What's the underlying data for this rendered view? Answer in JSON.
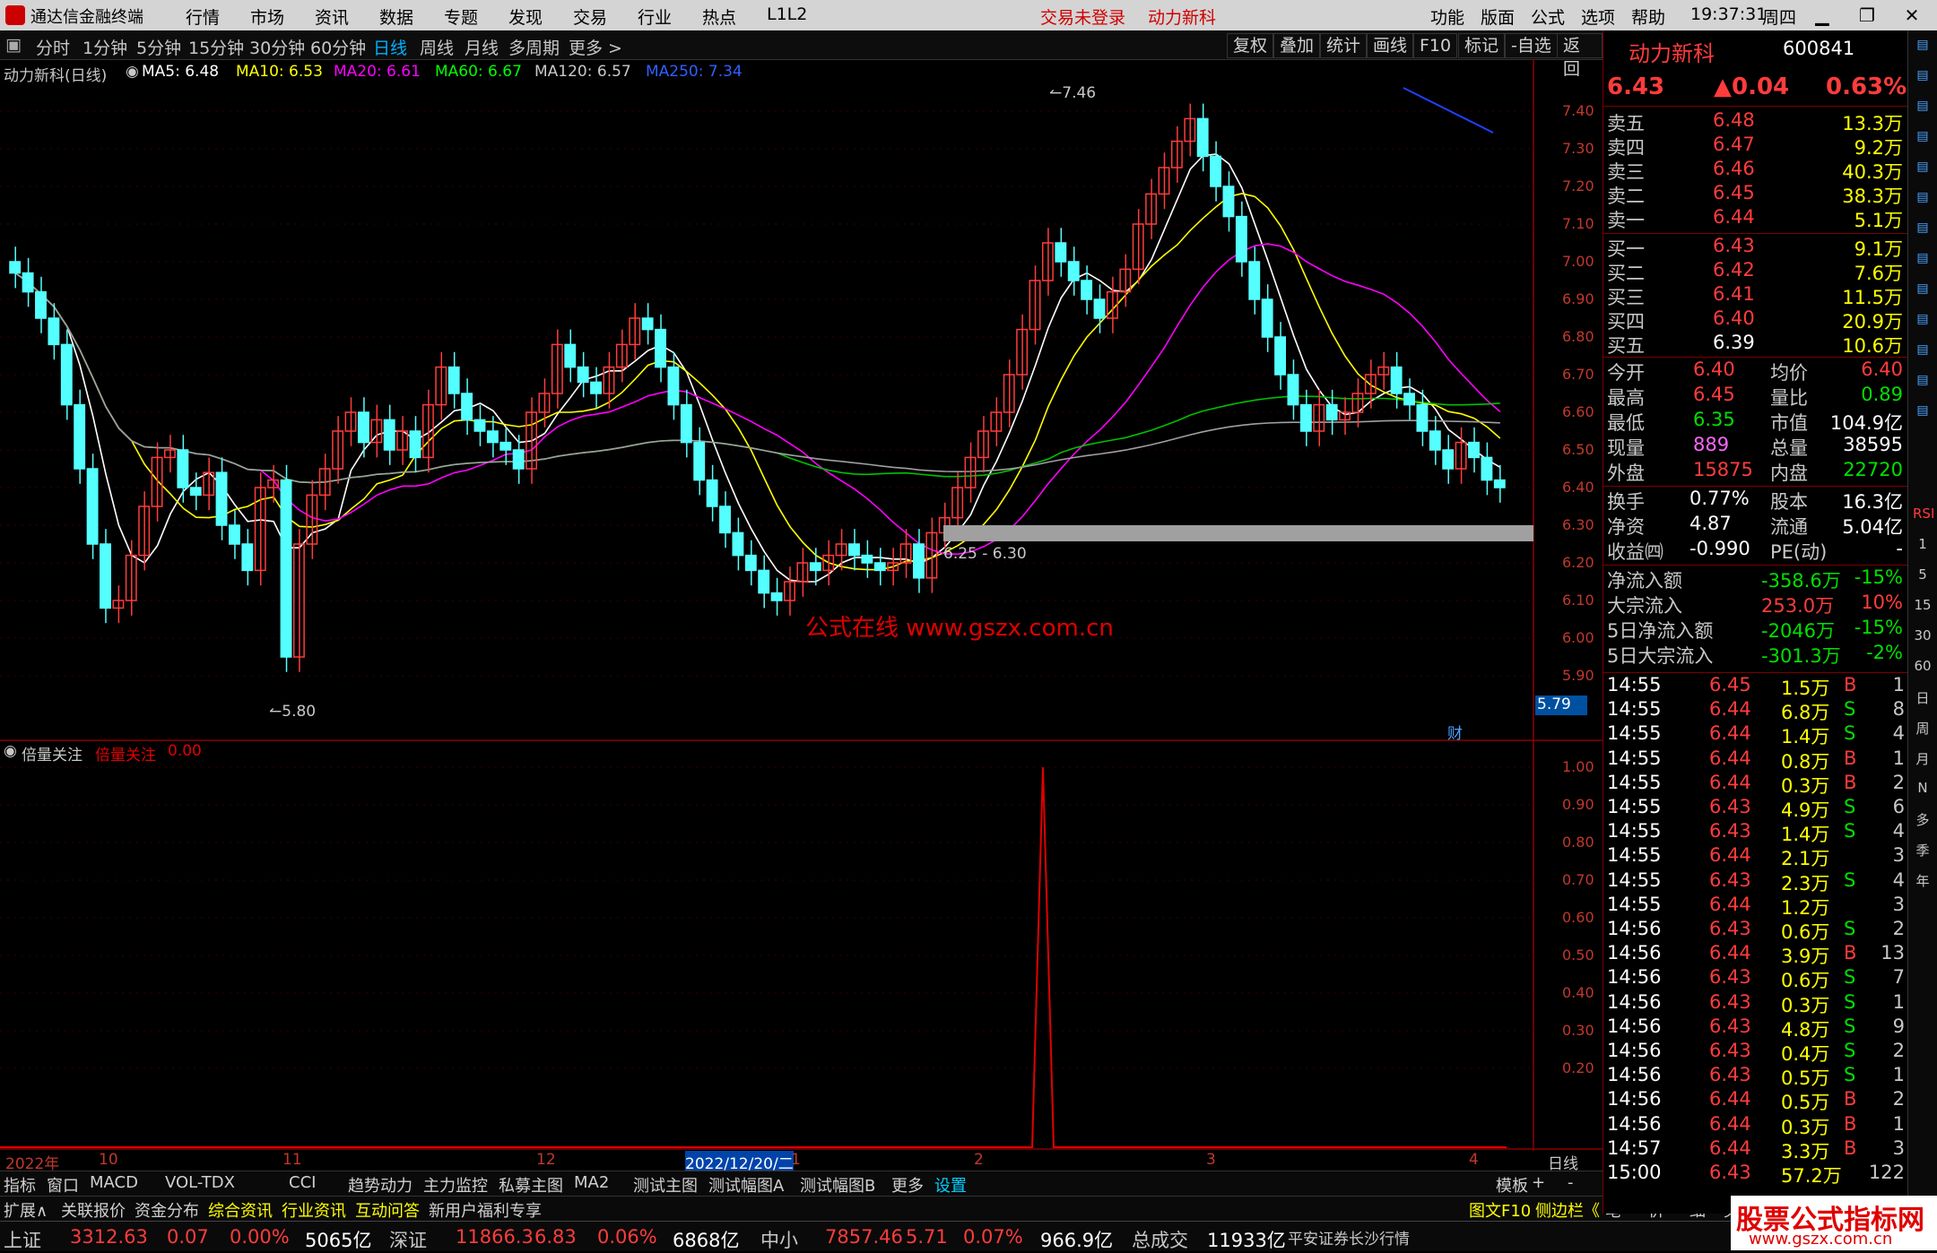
{
  "titlebar": {
    "app_name": "通达信金融终端",
    "menus": [
      "行情",
      "市场",
      "资讯",
      "数据",
      "专题",
      "发现",
      "交易",
      "行业",
      "热点",
      "L1L2"
    ],
    "trade_status": "交易未登录",
    "stock_name": "动力新科",
    "right_menus": [
      "功能",
      "版面",
      "公式",
      "选项",
      "帮助"
    ],
    "time": "19:37:31",
    "weekday": "周四"
  },
  "toolbar": {
    "periods": [
      "分时",
      "1分钟",
      "5分钟",
      "15分钟",
      "30分钟",
      "60分钟",
      "日线",
      "周线",
      "月线",
      "多周期",
      "更多 >"
    ],
    "active_period": "日线",
    "right_buttons": [
      "复权",
      "叠加",
      "统计",
      "画线",
      "F10",
      "标记",
      "-自选",
      "返回"
    ]
  },
  "chart": {
    "title": "动力新科(日线)",
    "ma": [
      {
        "label": "MA5: 6.48",
        "color": "#ffffff"
      },
      {
        "label": "MA10: 6.53",
        "color": "#ffff00"
      },
      {
        "label": "MA20: 6.61",
        "color": "#ff00ff"
      },
      {
        "label": "MA60: 6.67",
        "color": "#00ff00"
      },
      {
        "label": "MA120: 6.57",
        "color": "#c8c8c8"
      },
      {
        "label": "MA250: 7.34",
        "color": "#3060ff"
      }
    ],
    "price_ticks": [
      "7.40",
      "7.30",
      "7.20",
      "7.10",
      "7.00",
      "6.90",
      "6.80",
      "6.70",
      "6.60",
      "6.50",
      "6.40",
      "6.30",
      "6.20",
      "6.10",
      "6.00",
      "5.90"
    ],
    "annot_high": "7.46",
    "annot_low": "5.80",
    "annot_range": "6.25 - 6.30",
    "watermark": "公式在线  www.gszx.com.cn",
    "last_price_box": "5.79",
    "cai_label": "财",
    "date_labels": [
      "2022年",
      "10",
      "11",
      "12",
      "2022/12/20/二",
      "1",
      "2",
      "3",
      "4"
    ],
    "period_label": "日线"
  },
  "indicator": {
    "name": "倍量关注",
    "name2": "倍量关注",
    "value": "0.00",
    "ticks": [
      "1.00",
      "0.90",
      "0.80",
      "0.70",
      "0.60",
      "0.50",
      "0.40",
      "0.30",
      "0.20"
    ]
  },
  "bottom_tabs": [
    "指标",
    "窗口",
    "MACD",
    "VOL-TDX",
    "CCI",
    "趋势动力",
    "主力监控",
    "私募主图",
    "MA2",
    "测试主图",
    "测试幅图A",
    "测试幅图B",
    "更多",
    "设置"
  ],
  "bottom_tabs_right": [
    "模板",
    "+",
    "-"
  ],
  "bottom_tabs2": [
    {
      "label": "扩展∧",
      "color": "#d0d0d0"
    },
    {
      "label": "关联报价",
      "color": "#d0d0d0"
    },
    {
      "label": "资金分布",
      "color": "#d0d0d0"
    },
    {
      "label": "综合资讯",
      "color": "#ffff00"
    },
    {
      "label": "行业资讯",
      "color": "#ffff00"
    },
    {
      "label": "互动问答",
      "color": "#ffff00"
    },
    {
      "label": "新用户福利专享",
      "color": "#d0d0d0"
    }
  ],
  "bottom_right2": [
    "图文F10",
    "侧边栏《",
    "笔",
    "价",
    "细",
    "势"
  ],
  "quote": {
    "name": "动力新科",
    "code": "600841",
    "price": "6.43",
    "change": "▲0.04",
    "pct": "0.63%",
    "asks": [
      {
        "label": "卖五",
        "price": "6.48",
        "vol": "13.3万"
      },
      {
        "label": "卖四",
        "price": "6.47",
        "vol": "9.2万"
      },
      {
        "label": "卖三",
        "price": "6.46",
        "vol": "40.3万"
      },
      {
        "label": "卖二",
        "price": "6.45",
        "vol": "38.3万"
      },
      {
        "label": "卖一",
        "price": "6.44",
        "vol": "5.1万"
      }
    ],
    "bids": [
      {
        "label": "买一",
        "price": "6.43",
        "vol": "9.1万"
      },
      {
        "label": "买二",
        "price": "6.42",
        "vol": "7.6万"
      },
      {
        "label": "买三",
        "price": "6.41",
        "vol": "11.5万"
      },
      {
        "label": "买四",
        "price": "6.40",
        "vol": "20.9万"
      },
      {
        "label": "买五",
        "price": "6.39",
        "vol": "10.6万"
      }
    ],
    "stats": [
      {
        "l1": "今开",
        "v1": "6.40",
        "c1": "#ff3c3c",
        "l2": "均价",
        "v2": "6.40",
        "c2": "#ff3c3c"
      },
      {
        "l1": "最高",
        "v1": "6.45",
        "c1": "#ff3c3c",
        "l2": "量比",
        "v2": "0.89",
        "c2": "#00e000"
      },
      {
        "l1": "最低",
        "v1": "6.35",
        "c1": "#00e000",
        "l2": "市值",
        "v2": "104.9亿",
        "c2": "#ffffff"
      },
      {
        "l1": "现量",
        "v1": "889",
        "c1": "#ff66ff",
        "l2": "总量",
        "v2": "38595",
        "c2": "#ffffff"
      },
      {
        "l1": "外盘",
        "v1": "15875",
        "c1": "#ff3c3c",
        "l2": "内盘",
        "v2": "22720",
        "c2": "#00e000"
      }
    ],
    "stats2": [
      {
        "l1": "换手",
        "v1": "0.77%",
        "l2": "股本",
        "v2": "16.3亿"
      },
      {
        "l1": "净资",
        "v1": "4.87",
        "l2": "流通",
        "v2": "5.04亿"
      },
      {
        "l1": "收益㈣",
        "v1": "-0.990",
        "l2": "PE(动)",
        "v2": "-"
      }
    ],
    "flows": [
      {
        "label": "净流入额",
        "value": "-358.6万",
        "pct": "-15%",
        "color": "#00e000"
      },
      {
        "label": "大宗流入",
        "value": "253.0万",
        "pct": "10%",
        "color": "#ff3c3c"
      },
      {
        "label": "5日净流入额",
        "value": "-2046万",
        "pct": "-15%",
        "color": "#00e000"
      },
      {
        "label": "5日大宗流入",
        "value": "-301.3万",
        "pct": "-2%",
        "color": "#00e000"
      }
    ],
    "ticks": [
      {
        "t": "14:55",
        "p": "6.45",
        "pc": "#ff3c3c",
        "v": "1.5万",
        "bs": "B",
        "n": "1"
      },
      {
        "t": "14:55",
        "p": "6.44",
        "pc": "#ff3c3c",
        "v": "6.8万",
        "bs": "S",
        "n": "8"
      },
      {
        "t": "14:55",
        "p": "6.44",
        "pc": "#ff3c3c",
        "v": "1.4万",
        "bs": "S",
        "n": "4"
      },
      {
        "t": "14:55",
        "p": "6.44",
        "pc": "#ff3c3c",
        "v": "0.8万",
        "bs": "B",
        "n": "1"
      },
      {
        "t": "14:55",
        "p": "6.44",
        "pc": "#ff3c3c",
        "v": "0.3万",
        "bs": "B",
        "n": "2"
      },
      {
        "t": "14:55",
        "p": "6.43",
        "pc": "#ff3c3c",
        "v": "4.9万",
        "bs": "S",
        "n": "6"
      },
      {
        "t": "14:55",
        "p": "6.43",
        "pc": "#ff3c3c",
        "v": "1.4万",
        "bs": "S",
        "n": "4"
      },
      {
        "t": "14:55",
        "p": "6.44",
        "pc": "#ff3c3c",
        "v": "2.1万",
        "bs": "",
        "n": "3"
      },
      {
        "t": "14:55",
        "p": "6.43",
        "pc": "#ff3c3c",
        "v": "2.3万",
        "bs": "S",
        "n": "4"
      },
      {
        "t": "14:55",
        "p": "6.44",
        "pc": "#ff3c3c",
        "v": "1.2万",
        "bs": "",
        "n": "3"
      },
      {
        "t": "14:56",
        "p": "6.43",
        "pc": "#ff3c3c",
        "v": "0.6万",
        "bs": "S",
        "n": "2"
      },
      {
        "t": "14:56",
        "p": "6.44",
        "pc": "#ff3c3c",
        "v": "3.9万",
        "bs": "B",
        "n": "13"
      },
      {
        "t": "14:56",
        "p": "6.43",
        "pc": "#ff3c3c",
        "v": "0.6万",
        "bs": "S",
        "n": "7"
      },
      {
        "t": "14:56",
        "p": "6.43",
        "pc": "#ff3c3c",
        "v": "0.3万",
        "bs": "S",
        "n": "1"
      },
      {
        "t": "14:56",
        "p": "6.43",
        "pc": "#ff3c3c",
        "v": "4.8万",
        "bs": "S",
        "n": "9"
      },
      {
        "t": "14:56",
        "p": "6.43",
        "pc": "#ff3c3c",
        "v": "0.4万",
        "bs": "S",
        "n": "2"
      },
      {
        "t": "14:56",
        "p": "6.43",
        "pc": "#ff3c3c",
        "v": "0.5万",
        "bs": "S",
        "n": "1"
      },
      {
        "t": "14:56",
        "p": "6.44",
        "pc": "#ff3c3c",
        "v": "0.5万",
        "bs": "B",
        "n": "2"
      },
      {
        "t": "14:56",
        "p": "6.44",
        "pc": "#ff3c3c",
        "v": "0.3万",
        "bs": "B",
        "n": "1"
      },
      {
        "t": "14:57",
        "p": "6.44",
        "pc": "#ff3c3c",
        "v": "3.3万",
        "bs": "B",
        "n": "3"
      },
      {
        "t": "15:00",
        "p": "6.43",
        "pc": "#ff3c3c",
        "v": "57.2万",
        "bs": "",
        "n": "122"
      }
    ]
  },
  "sidebar_labels": [
    "RSI",
    "1",
    "5",
    "15",
    "30",
    "60",
    "日",
    "周",
    "月",
    "N",
    "多",
    "季",
    "年"
  ],
  "statusbar": [
    {
      "text": "上证",
      "c": "#c8c8c8"
    },
    {
      "text": "3312.63",
      "c": "#ff3c3c"
    },
    {
      "text": "0.07",
      "c": "#ff3c3c"
    },
    {
      "text": "0.00%",
      "c": "#ff3c3c"
    },
    {
      "text": "5065亿",
      "c": "#ffffff"
    },
    {
      "text": "深证",
      "c": "#c8c8c8"
    },
    {
      "text": "11866.3",
      "c": "#ff3c3c"
    },
    {
      "text": "6.83",
      "c": "#ff3c3c"
    },
    {
      "text": "0.06%",
      "c": "#ff3c3c"
    },
    {
      "text": "6868亿",
      "c": "#ffffff"
    },
    {
      "text": "中小",
      "c": "#c8c8c8"
    },
    {
      "text": "7857.46",
      "c": "#ff3c3c"
    },
    {
      "text": "5.71",
      "c": "#ff3c3c"
    },
    {
      "text": "0.07%",
      "c": "#ff3c3c"
    },
    {
      "text": "966.9亿",
      "c": "#ffffff"
    },
    {
      "text": "总成交",
      "c": "#c8c8c8"
    },
    {
      "text": "11933亿",
      "c": "#ffffff"
    },
    {
      "text": "平安证券长沙行情",
      "c": "#c8c8c8"
    }
  ],
  "watermark_corner": {
    "title": "股票公式指标网",
    "url": "www.gszx.com.cn"
  }
}
